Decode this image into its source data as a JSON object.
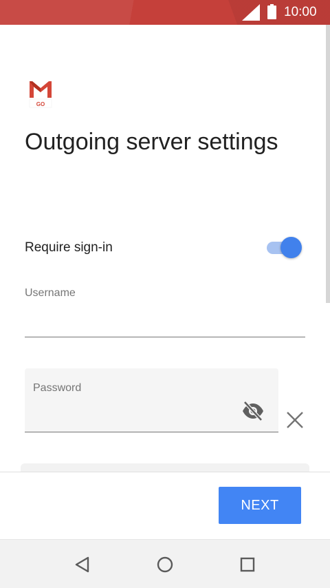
{
  "status_bar": {
    "time": "10:00",
    "icons": [
      "signal-icon",
      "battery-icon"
    ],
    "background_color": "#c5403a"
  },
  "app": {
    "logo_icon": "gmail-go-logo",
    "logo_text": "GO"
  },
  "page": {
    "title": "Outgoing server settings"
  },
  "require_signin": {
    "label": "Require sign-in",
    "enabled": true,
    "accent_color": "#4181ec"
  },
  "username": {
    "label": "Username",
    "value": ""
  },
  "password": {
    "label": "Password",
    "value": "",
    "visibility_icon": "visibility-off-icon",
    "clear_icon": "close-icon"
  },
  "footer": {
    "next_label": "NEXT",
    "button_color": "#4285f4"
  },
  "nav_bar": {
    "icons": [
      "back-icon",
      "home-icon",
      "recents-icon"
    ]
  }
}
